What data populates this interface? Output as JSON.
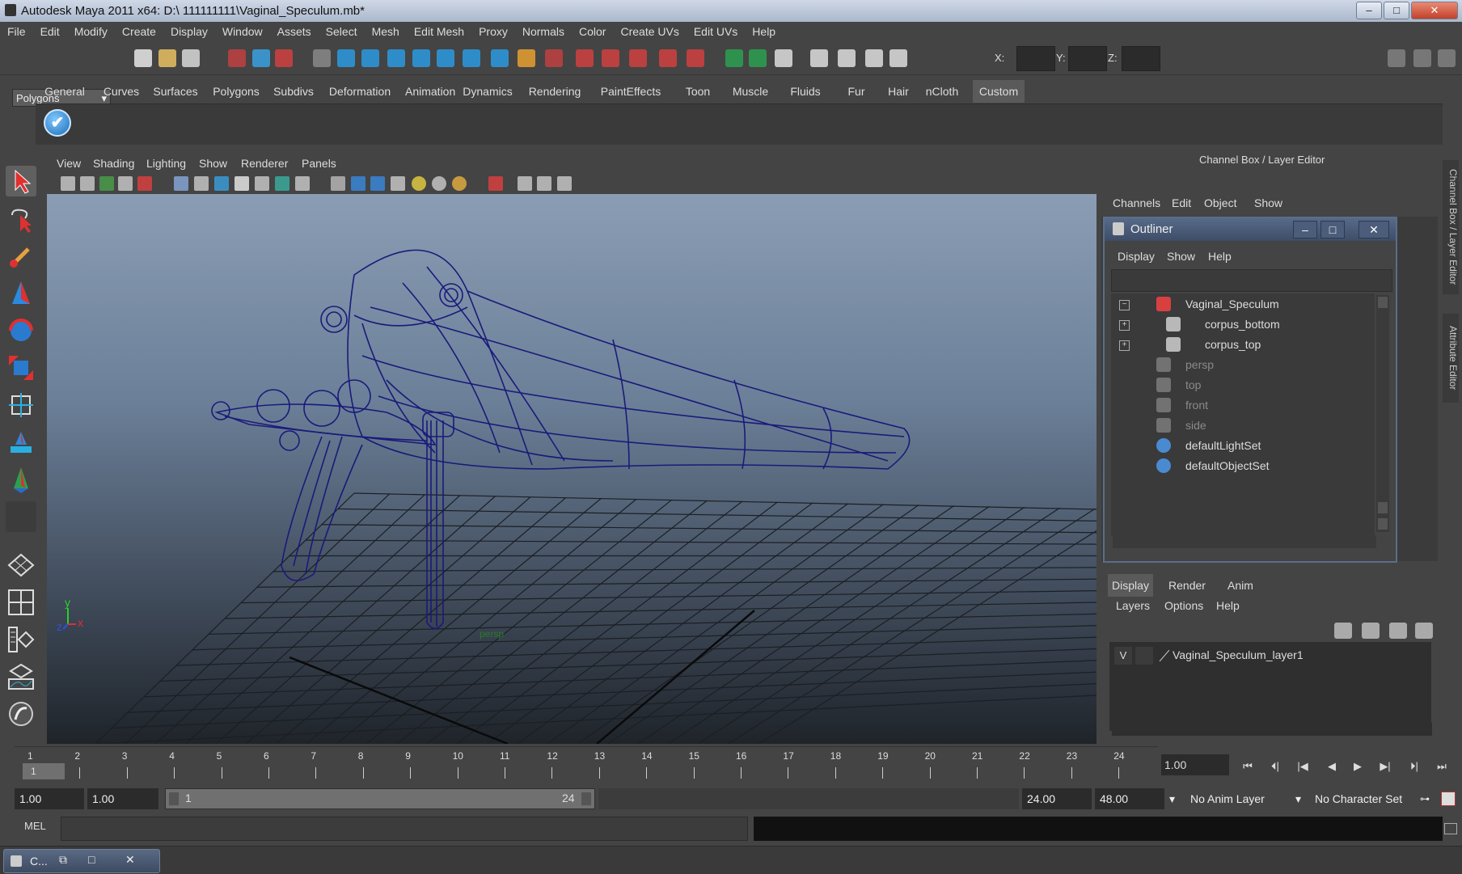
{
  "window": {
    "title": "Autodesk Maya 2011 x64: D:\\  111111111\\Vaginal_Speculum.mb*",
    "min": "–",
    "max": "□",
    "close": "✕"
  },
  "menubar": [
    "File",
    "Edit",
    "Modify",
    "Create",
    "Display",
    "Window",
    "Assets",
    "Select",
    "Mesh",
    "Edit Mesh",
    "Proxy",
    "Normals",
    "Color",
    "Create UVs",
    "Edit UVs",
    "Help"
  ],
  "status_line": {
    "mode": "Polygons",
    "x_label": "X:",
    "y_label": "Y:",
    "z_label": "Z:"
  },
  "shelf": {
    "tabs": [
      "General",
      "Curves",
      "Surfaces",
      "Polygons",
      "Subdivs",
      "Deformation",
      "Animation",
      "Dynamics",
      "Rendering",
      "PaintEffects",
      "Toon",
      "Muscle",
      "Fluids",
      "Fur",
      "Hair",
      "nCloth",
      "Custom"
    ],
    "active_tab": "Custom",
    "icon_glyph": "✔"
  },
  "panel": {
    "menus": [
      "View",
      "Shading",
      "Lighting",
      "Show",
      "Renderer",
      "Panels"
    ],
    "camera_label": "persp",
    "axis_y": "y",
    "axis_x": "x",
    "axis_z": "z"
  },
  "channel_box": {
    "title": "Channel Box / Layer Editor",
    "menus": [
      "Channels",
      "Edit",
      "Object",
      "Show"
    ]
  },
  "outliner": {
    "title": "Outliner",
    "menus": [
      "Display",
      "Show",
      "Help"
    ],
    "items": [
      {
        "label": "Vaginal_Speculum",
        "expand": "−",
        "dim": false
      },
      {
        "label": "corpus_bottom",
        "expand": "+",
        "dim": false
      },
      {
        "label": "corpus_top",
        "expand": "+",
        "dim": false
      },
      {
        "label": "persp",
        "expand": "",
        "dim": true
      },
      {
        "label": "top",
        "expand": "",
        "dim": true
      },
      {
        "label": "front",
        "expand": "",
        "dim": true
      },
      {
        "label": "side",
        "expand": "",
        "dim": true
      },
      {
        "label": "defaultLightSet",
        "expand": "",
        "dim": false
      },
      {
        "label": "defaultObjectSet",
        "expand": "",
        "dim": false
      }
    ]
  },
  "layer_editor": {
    "tabs": [
      "Display",
      "Render",
      "Anim"
    ],
    "active_tab": "Display",
    "menus": [
      "Layers",
      "Options",
      "Help"
    ],
    "layer": {
      "visible": "V",
      "name": "Vaginal_Speculum_layer1"
    }
  },
  "side_tabs": [
    "Channel Box / Layer Editor",
    "Attribute Editor"
  ],
  "time_slider": {
    "frames": [
      "1",
      "2",
      "3",
      "4",
      "5",
      "6",
      "7",
      "8",
      "9",
      "10",
      "11",
      "12",
      "13",
      "14",
      "15",
      "16",
      "17",
      "18",
      "19",
      "20",
      "21",
      "22",
      "23",
      "24"
    ],
    "current_frame_marker": "1",
    "current_time": "1.00"
  },
  "range_slider": {
    "start_time": "1.00",
    "playback_start": "1.00",
    "range_start": "1",
    "range_end": "24",
    "playback_end": "24.00",
    "end_time": "48.00",
    "anim_layer": "No Anim Layer",
    "character_set": "No Character Set"
  },
  "playback": [
    "⏮",
    "⏴|",
    "|◀",
    "◀",
    "▶",
    "▶|",
    "⏵|",
    "⏭"
  ],
  "command_line": {
    "label": "MEL",
    "value": ""
  },
  "taskbar": {
    "minimized_label": "C...",
    "btn_restore": "⧉",
    "btn_max": "□",
    "btn_close": "✕"
  },
  "colors": {
    "wireframe": "#1a1a7a",
    "grid": "#1b1f24",
    "accent_tab": "#5a5a5a"
  }
}
